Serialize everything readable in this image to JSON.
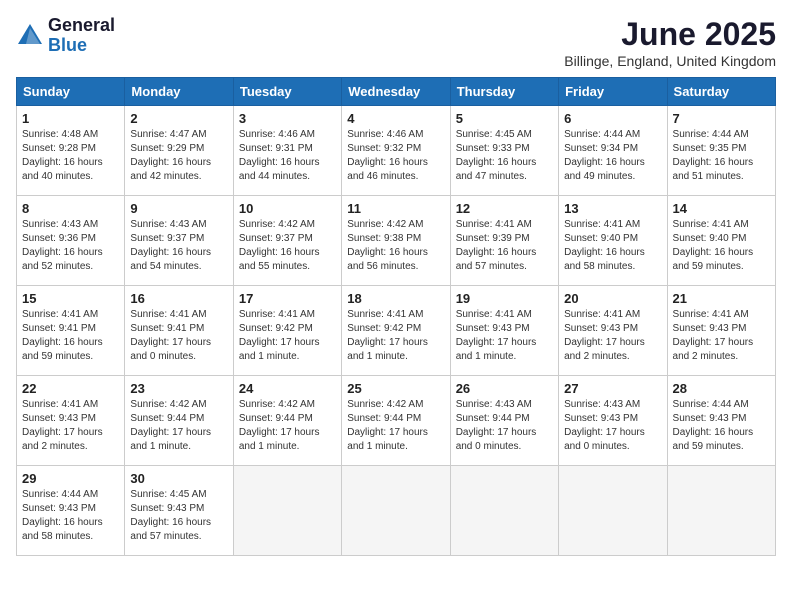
{
  "logo": {
    "general": "General",
    "blue": "Blue"
  },
  "title": "June 2025",
  "subtitle": "Billinge, England, United Kingdom",
  "headers": [
    "Sunday",
    "Monday",
    "Tuesday",
    "Wednesday",
    "Thursday",
    "Friday",
    "Saturday"
  ],
  "weeks": [
    [
      {
        "day": "1",
        "info": "Sunrise: 4:48 AM\nSunset: 9:28 PM\nDaylight: 16 hours\nand 40 minutes."
      },
      {
        "day": "2",
        "info": "Sunrise: 4:47 AM\nSunset: 9:29 PM\nDaylight: 16 hours\nand 42 minutes."
      },
      {
        "day": "3",
        "info": "Sunrise: 4:46 AM\nSunset: 9:31 PM\nDaylight: 16 hours\nand 44 minutes."
      },
      {
        "day": "4",
        "info": "Sunrise: 4:46 AM\nSunset: 9:32 PM\nDaylight: 16 hours\nand 46 minutes."
      },
      {
        "day": "5",
        "info": "Sunrise: 4:45 AM\nSunset: 9:33 PM\nDaylight: 16 hours\nand 47 minutes."
      },
      {
        "day": "6",
        "info": "Sunrise: 4:44 AM\nSunset: 9:34 PM\nDaylight: 16 hours\nand 49 minutes."
      },
      {
        "day": "7",
        "info": "Sunrise: 4:44 AM\nSunset: 9:35 PM\nDaylight: 16 hours\nand 51 minutes."
      }
    ],
    [
      {
        "day": "8",
        "info": "Sunrise: 4:43 AM\nSunset: 9:36 PM\nDaylight: 16 hours\nand 52 minutes."
      },
      {
        "day": "9",
        "info": "Sunrise: 4:43 AM\nSunset: 9:37 PM\nDaylight: 16 hours\nand 54 minutes."
      },
      {
        "day": "10",
        "info": "Sunrise: 4:42 AM\nSunset: 9:37 PM\nDaylight: 16 hours\nand 55 minutes."
      },
      {
        "day": "11",
        "info": "Sunrise: 4:42 AM\nSunset: 9:38 PM\nDaylight: 16 hours\nand 56 minutes."
      },
      {
        "day": "12",
        "info": "Sunrise: 4:41 AM\nSunset: 9:39 PM\nDaylight: 16 hours\nand 57 minutes."
      },
      {
        "day": "13",
        "info": "Sunrise: 4:41 AM\nSunset: 9:40 PM\nDaylight: 16 hours\nand 58 minutes."
      },
      {
        "day": "14",
        "info": "Sunrise: 4:41 AM\nSunset: 9:40 PM\nDaylight: 16 hours\nand 59 minutes."
      }
    ],
    [
      {
        "day": "15",
        "info": "Sunrise: 4:41 AM\nSunset: 9:41 PM\nDaylight: 16 hours\nand 59 minutes."
      },
      {
        "day": "16",
        "info": "Sunrise: 4:41 AM\nSunset: 9:41 PM\nDaylight: 17 hours\nand 0 minutes."
      },
      {
        "day": "17",
        "info": "Sunrise: 4:41 AM\nSunset: 9:42 PM\nDaylight: 17 hours\nand 1 minute."
      },
      {
        "day": "18",
        "info": "Sunrise: 4:41 AM\nSunset: 9:42 PM\nDaylight: 17 hours\nand 1 minute."
      },
      {
        "day": "19",
        "info": "Sunrise: 4:41 AM\nSunset: 9:43 PM\nDaylight: 17 hours\nand 1 minute."
      },
      {
        "day": "20",
        "info": "Sunrise: 4:41 AM\nSunset: 9:43 PM\nDaylight: 17 hours\nand 2 minutes."
      },
      {
        "day": "21",
        "info": "Sunrise: 4:41 AM\nSunset: 9:43 PM\nDaylight: 17 hours\nand 2 minutes."
      }
    ],
    [
      {
        "day": "22",
        "info": "Sunrise: 4:41 AM\nSunset: 9:43 PM\nDaylight: 17 hours\nand 2 minutes."
      },
      {
        "day": "23",
        "info": "Sunrise: 4:42 AM\nSunset: 9:44 PM\nDaylight: 17 hours\nand 1 minute."
      },
      {
        "day": "24",
        "info": "Sunrise: 4:42 AM\nSunset: 9:44 PM\nDaylight: 17 hours\nand 1 minute."
      },
      {
        "day": "25",
        "info": "Sunrise: 4:42 AM\nSunset: 9:44 PM\nDaylight: 17 hours\nand 1 minute."
      },
      {
        "day": "26",
        "info": "Sunrise: 4:43 AM\nSunset: 9:44 PM\nDaylight: 17 hours\nand 0 minutes."
      },
      {
        "day": "27",
        "info": "Sunrise: 4:43 AM\nSunset: 9:43 PM\nDaylight: 17 hours\nand 0 minutes."
      },
      {
        "day": "28",
        "info": "Sunrise: 4:44 AM\nSunset: 9:43 PM\nDaylight: 16 hours\nand 59 minutes."
      }
    ],
    [
      {
        "day": "29",
        "info": "Sunrise: 4:44 AM\nSunset: 9:43 PM\nDaylight: 16 hours\nand 58 minutes."
      },
      {
        "day": "30",
        "info": "Sunrise: 4:45 AM\nSunset: 9:43 PM\nDaylight: 16 hours\nand 57 minutes."
      },
      {
        "day": "",
        "info": ""
      },
      {
        "day": "",
        "info": ""
      },
      {
        "day": "",
        "info": ""
      },
      {
        "day": "",
        "info": ""
      },
      {
        "day": "",
        "info": ""
      }
    ]
  ]
}
